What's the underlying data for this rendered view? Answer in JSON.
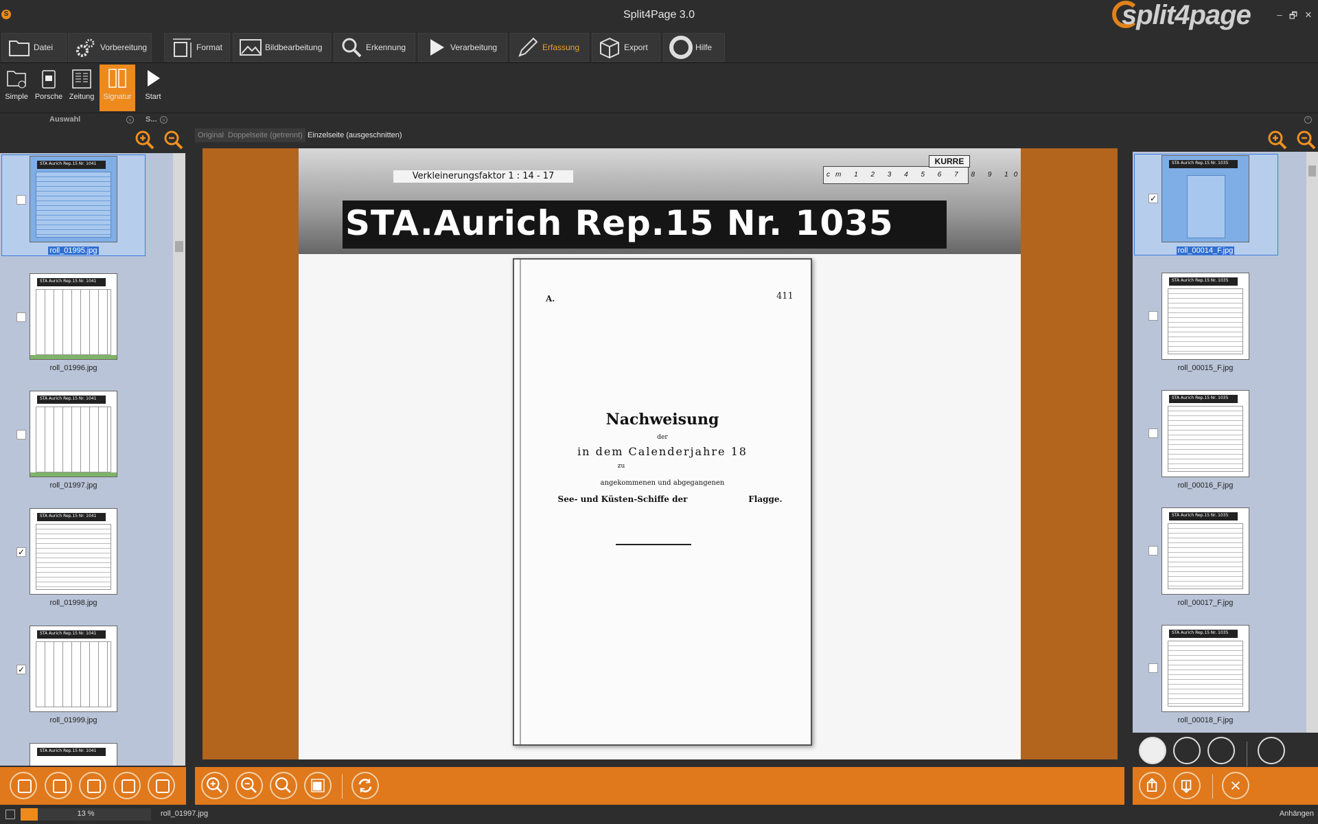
{
  "window": {
    "title": "Split4Page 3.0",
    "brand": "split4page",
    "app_icon_glyph": "S",
    "controls": [
      "–",
      "🗗",
      "✕"
    ]
  },
  "main_tabs": [
    {
      "label": "Datei",
      "icon": "folder-icon"
    },
    {
      "label": "Vorbereitung",
      "icon": "gears-icon"
    },
    {
      "label": "Format",
      "icon": "resize-icon"
    },
    {
      "label": "Bildbearbeitung",
      "icon": "image-icon"
    },
    {
      "label": "Erkennung",
      "icon": "magnifier-icon"
    },
    {
      "label": "Verarbeitung",
      "icon": "play-icon"
    },
    {
      "label": "Erfassung",
      "icon": "pencil-icon",
      "active": true
    },
    {
      "label": "Export",
      "icon": "box-icon"
    },
    {
      "label": "Hilfe",
      "icon": "lifebuoy-icon"
    }
  ],
  "sub_tools": [
    {
      "label": "Simple"
    },
    {
      "label": "Porsche"
    },
    {
      "label": "Zeitung"
    },
    {
      "label": "Signatur",
      "active": true
    },
    {
      "label": "Start"
    }
  ],
  "panels": {
    "left_header": "Auswahl",
    "second_header": "S...",
    "left_header_btn": "»",
    "right_header_btn": "^"
  },
  "left_thumbs": [
    {
      "name": "roll_01995.jpg",
      "checked": false,
      "selected": true,
      "tinted": true
    },
    {
      "name": "roll_01996.jpg",
      "checked": false,
      "selected": false
    },
    {
      "name": "roll_01997.jpg",
      "checked": false,
      "selected": false
    },
    {
      "name": "roll_01998.jpg",
      "checked": true,
      "selected": false
    },
    {
      "name": "roll_01999.jpg",
      "checked": true,
      "selected": false
    }
  ],
  "thumb_banner": "STA Aurich Rep.15 Nr. 1041",
  "right_thumb_banner": "STA Aurich Rep.15 Nr. 1035",
  "right_thumbs": [
    {
      "name": "roll_00014_F.jpg",
      "checked": true,
      "selected": true,
      "tinted": true
    },
    {
      "name": "roll_00015_F.jpg",
      "checked": false
    },
    {
      "name": "roll_00016_F.jpg",
      "checked": false
    },
    {
      "name": "roll_00017_F.jpg",
      "checked": false
    },
    {
      "name": "roll_00018_F.jpg",
      "checked": false
    }
  ],
  "view_tabs": [
    {
      "label": "Original"
    },
    {
      "label": "Doppelseite (getrennt)"
    },
    {
      "label": "Einzelseite (ausgeschnitten)",
      "active": true
    }
  ],
  "scan": {
    "scale_label": "Verkleinerungsfaktor 1 : 14 - 17",
    "ruler_label": "cm 1 2 3 4 5 6 7 8 9 10",
    "kurre": "KURRE",
    "signature": "STA.Aurich Rep.15  Nr.  1035",
    "doc_letter": "A.",
    "doc_number": "411",
    "doc_title": "Nachweisung",
    "doc_lines": [
      "der",
      "in dem Calenderjahre 18",
      "zu",
      "angekommenen und abgegangenen",
      "See- und Küsten-Schiffe der",
      "Flagge."
    ]
  },
  "status": {
    "progress_text": "13 %",
    "progress_value": 0.13,
    "file": "roll_01997.jpg",
    "right": "Anhängen"
  },
  "colors": {
    "accent": "#ee8a1c",
    "bottom_bar": "#e0781c",
    "viewer_bg": "#b3651e",
    "list_bg": "#b9c4d8",
    "selection": "#2f6fd0"
  }
}
